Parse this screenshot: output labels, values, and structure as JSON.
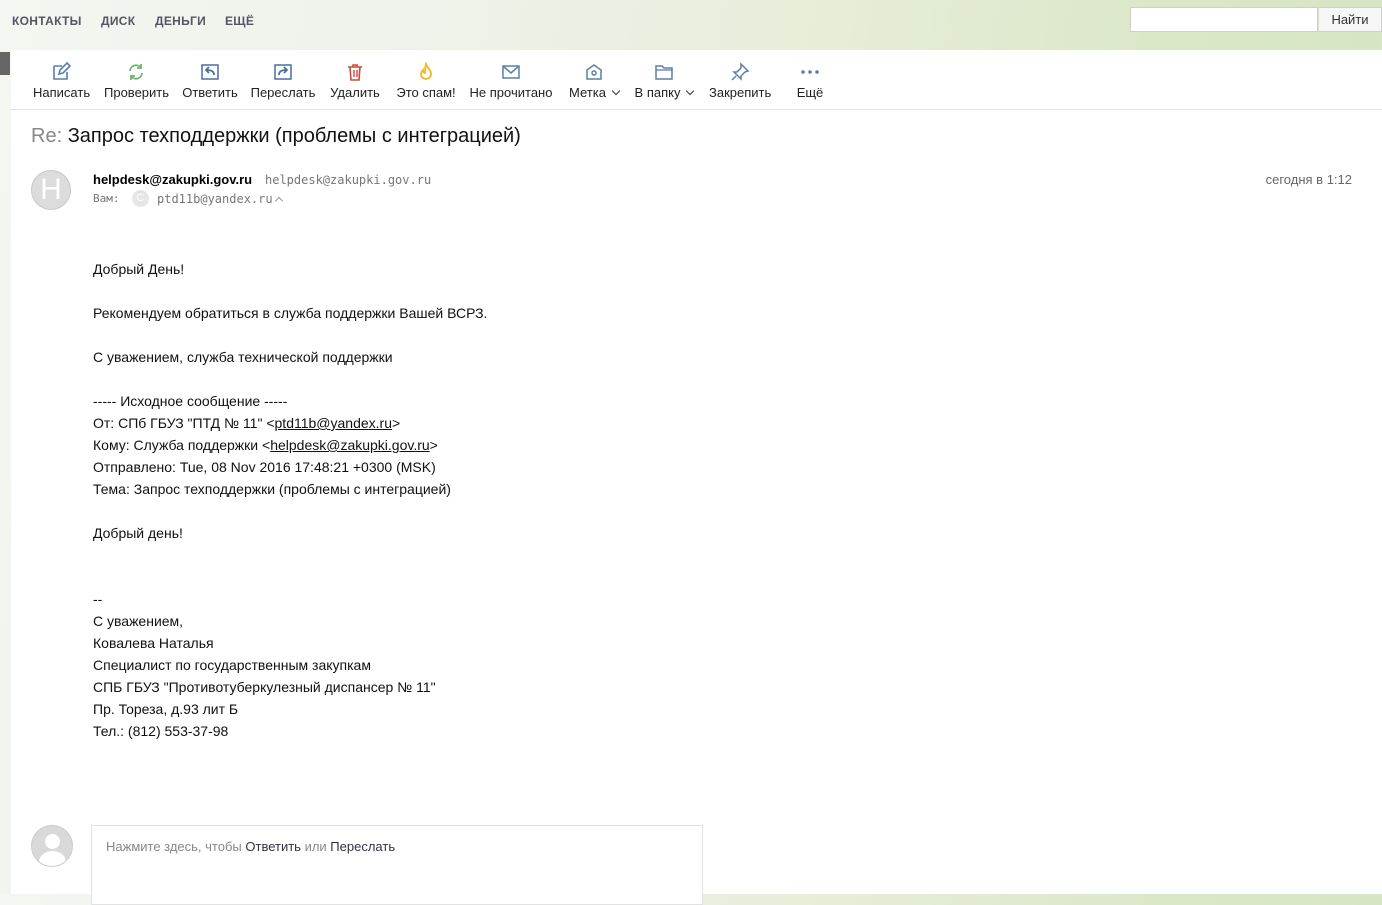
{
  "topnav": {
    "links": [
      "КОНТАКТЫ",
      "ДИСК",
      "ДЕНЬГИ",
      "ЕЩЁ"
    ],
    "search_value": "",
    "search_button": "Найти"
  },
  "toolbar": {
    "compose": "Написать",
    "check": "Проверить",
    "reply": "Ответить",
    "forward": "Переслать",
    "delete": "Удалить",
    "spam": "Это спам!",
    "unread": "Не прочитано",
    "label": "Метка",
    "folder": "В папку",
    "pin": "Закрепить",
    "more": "Ещё"
  },
  "message": {
    "subject_prefix": "Re:",
    "subject": "Запрос техподдержки (проблемы с интеграцией)",
    "avatar_letter": "H",
    "from_name": "helpdesk@zakupki.gov.ru",
    "from_address": "helpdesk@zakupki.gov.ru",
    "to_label": "Вам:",
    "to_avatar_letter": "C",
    "to_address": "ptd11b@yandex.ru",
    "date": "сегодня в 1:12",
    "body": {
      "greeting": "Добрый День!",
      "recommend": "Рекомендуем обратиться в служба поддержки Вашей ВСРЗ.",
      "regards_support": "С уважением, служба технической поддержки",
      "original_header": "----- Исходное сообщение -----",
      "from_prefix": "От: СПб ГБУЗ \"ПТД № 11\" <",
      "from_email": "ptd11b@yandex.ru",
      "from_suffix": ">",
      "to_prefix": "Кому: Служба поддержки <",
      "to_email": "helpdesk@zakupki.gov.ru",
      "to_suffix": ">",
      "sent": "Отправлено: Tue, 08 Nov 2016 17:48:21 +0300 (MSK)",
      "topic": "Тема: Запрос техподдержки (проблемы с интеграцией)",
      "greeting2": "Добрый день!",
      "sig_sep": "--",
      "sig_regards": "С уважением,",
      "sig_name": "Ковалева Наталья",
      "sig_title": "Специалист по государственным закупкам",
      "sig_org": "СПБ ГБУЗ \"Противотуберкулезный диспансер № 11\"",
      "sig_address": "Пр. Тореза, д.93 лит Б",
      "sig_phone": "Тел.: (812) 553-37-98"
    }
  },
  "quick_reply": {
    "prefix": "Нажмите здесь, чтобы ",
    "reply": "Ответить",
    "or": " или ",
    "forward": "Переслать"
  },
  "colors": {
    "compose": "#5b7fa8",
    "check": "#6fb36f",
    "reply": "#4a6fa0",
    "forward": "#4a6fa0",
    "delete": "#d0483a",
    "spam": "#f2b61f",
    "muted": "#5b7fa8"
  }
}
